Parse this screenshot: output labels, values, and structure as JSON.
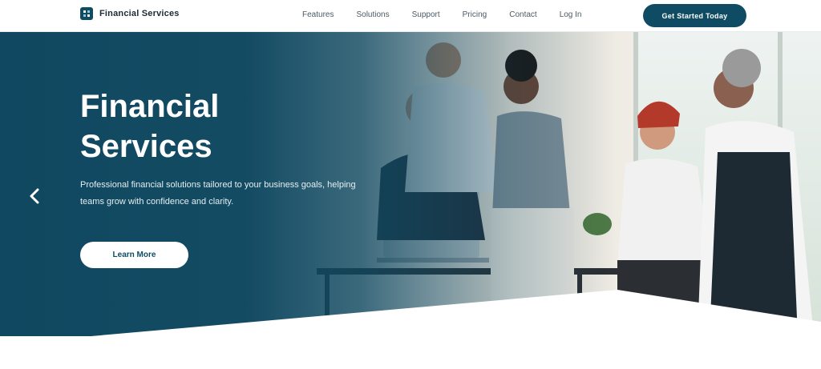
{
  "brand": {
    "name": "Financial Services"
  },
  "nav": {
    "items": [
      "Features",
      "Solutions",
      "Support",
      "Pricing",
      "Contact",
      "Log In"
    ],
    "cta_label": "Get Started Today"
  },
  "hero": {
    "title_line1": "Financial",
    "title_line2": "Services",
    "description": "Professional financial solutions tailored to your business goals, helping teams grow with confidence and clarity.",
    "button_label": "Learn More"
  },
  "colors": {
    "primary": "#0f4c63",
    "white": "#ffffff"
  }
}
